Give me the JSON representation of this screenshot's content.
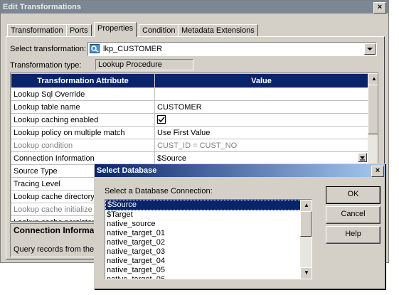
{
  "main_window": {
    "title": "Edit Transformations",
    "close_label": "×",
    "tabs": [
      {
        "label": "Transformation"
      },
      {
        "label": "Ports"
      },
      {
        "label": "Properties"
      },
      {
        "label": "Condition"
      },
      {
        "label": "Metadata Extensions"
      }
    ],
    "select_transformation_label": "Select transformation:",
    "selected_transformation": "lkp_CUSTOMER",
    "transformation_type_label": "Transformation type:",
    "transformation_type_value": "Lookup Procedure",
    "grid": {
      "col_attribute": "Transformation Attribute",
      "col_value": "Value",
      "rows": [
        {
          "attr": "Lookup Sql Override",
          "value": ""
        },
        {
          "attr": "Lookup table name",
          "value": "CUSTOMER"
        },
        {
          "attr": "Lookup caching enabled",
          "value": ""
        },
        {
          "attr": "Lookup policy on multiple match",
          "value": "Use First Value"
        },
        {
          "attr": "Lookup condition",
          "value": "CUST_ID = CUST_NO"
        },
        {
          "attr": "Connection Information",
          "value": "$Source"
        },
        {
          "attr": "Source Type",
          "value": ""
        },
        {
          "attr": "Tracing Level",
          "value": ""
        },
        {
          "attr": "Lookup cache directory",
          "value": ""
        },
        {
          "attr": "Lookup cache initialize",
          "value": ""
        },
        {
          "attr": "Lookup cache persistent",
          "value": ""
        }
      ]
    },
    "description_title": "Connection Informat",
    "description_text": "Query records from the s"
  },
  "dialog": {
    "title": "Select Database",
    "close_label": "×",
    "prompt": "Select a Database Connection:",
    "options": [
      "$Source",
      "$Target",
      "native_source",
      "native_target_01",
      "native_target_02",
      "native_target_03",
      "native_target_04",
      "native_target_05",
      "native_target_06"
    ],
    "ok_label": "OK",
    "cancel_label": "Cancel",
    "help_label": "Help"
  }
}
